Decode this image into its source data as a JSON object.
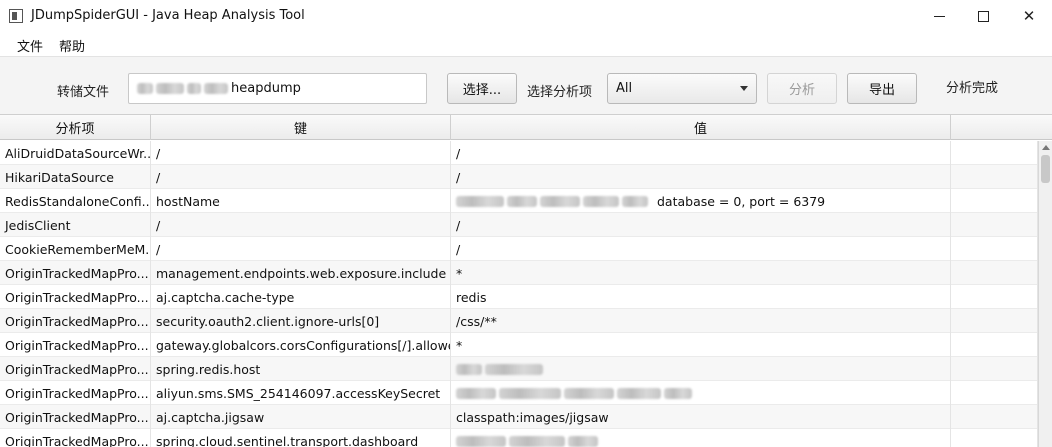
{
  "window": {
    "title": "JDumpSpiderGUI - Java Heap Analysis Tool",
    "minimize_symbol": "",
    "close_symbol": "✕"
  },
  "menu": {
    "items": [
      "文件",
      "帮助"
    ]
  },
  "toolbar": {
    "dump_label": "转储文件",
    "dump_value": "heapdump",
    "choose_button": "选择...",
    "analysis_label": "选择分析项",
    "analysis_selected": "All",
    "analyze_button": "分析",
    "export_button": "导出",
    "status_text": "分析完成"
  },
  "table": {
    "columns": [
      "分析项",
      "键",
      "值",
      ""
    ],
    "rows": [
      {
        "item": "AliDruidDataSourceWr...",
        "key": "/",
        "value": "/",
        "value_redacted": false
      },
      {
        "item": "HikariDataSource",
        "key": "/",
        "value": "/",
        "value_redacted": false
      },
      {
        "item": "RedisStandaloneConfi...",
        "key": "hostName",
        "value": "database = 0, port = 6379",
        "value_redacted": true
      },
      {
        "item": "JedisClient",
        "key": "/",
        "value": "/",
        "value_redacted": false
      },
      {
        "item": "CookieRememberMeM...",
        "key": "/",
        "value": "/",
        "value_redacted": false
      },
      {
        "item": "OriginTrackedMapPro...",
        "key": "management.endpoints.web.exposure.include",
        "value": "*",
        "value_redacted": false
      },
      {
        "item": "OriginTrackedMapPro...",
        "key": "aj.captcha.cache-type",
        "value": "redis",
        "value_redacted": false
      },
      {
        "item": "OriginTrackedMapPro...",
        "key": "security.oauth2.client.ignore-urls[0]",
        "value": "/css/**",
        "value_redacted": false
      },
      {
        "item": "OriginTrackedMapPro...",
        "key": "gateway.globalcors.corsConfigurations[/].allowed...",
        "value": "*",
        "value_redacted": false
      },
      {
        "item": "OriginTrackedMapPro...",
        "key": "spring.redis.host",
        "value": "",
        "value_redacted": true
      },
      {
        "item": "OriginTrackedMapPro...",
        "key": "aliyun.sms.SMS_254146097.accessKeySecret",
        "value": "",
        "value_redacted": true
      },
      {
        "item": "OriginTrackedMapPro...",
        "key": "aj.captcha.jigsaw",
        "value": "classpath:images/jigsaw",
        "value_redacted": false
      },
      {
        "item": "OriginTrackedMapPro...",
        "key": "spring.cloud.sentinel.transport.dashboard",
        "value": "",
        "value_redacted": true
      }
    ]
  }
}
